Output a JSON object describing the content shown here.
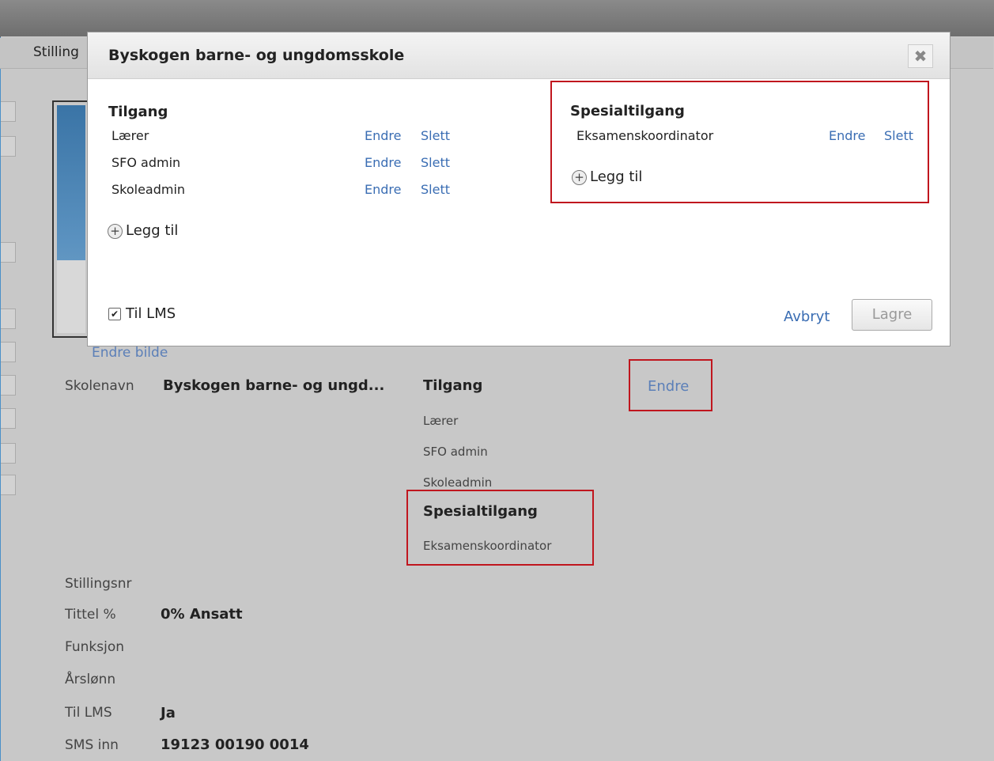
{
  "page": {
    "tab_label": "Stilling",
    "change_photo": "Endre bilde",
    "school": {
      "label": "Skolenavn",
      "value": "Byskogen barne- og ungd...",
      "access_heading": "Tilgang",
      "edit_link": "Endre",
      "access_items": [
        "Lærer",
        "SFO admin",
        "Skoleadmin"
      ],
      "special_heading": "Spesialtilgang",
      "special_items": [
        "Eksamenskoordinator"
      ]
    },
    "fields": [
      {
        "label": "Stillingsnr",
        "value": ""
      },
      {
        "label": "Tittel %",
        "value": "0% Ansatt"
      },
      {
        "label": "Funksjon",
        "value": ""
      },
      {
        "label": "Årslønn",
        "value": ""
      },
      {
        "label": "Til LMS",
        "value": "Ja"
      },
      {
        "label": "SMS inn",
        "value": "19123 00190 0014"
      }
    ]
  },
  "modal": {
    "title": "Byskogen barne- og ungdomsskole",
    "close_icon": "close-icon",
    "access": {
      "heading": "Tilgang",
      "rows": [
        {
          "name": "Lærer",
          "edit": "Endre",
          "delete": "Slett"
        },
        {
          "name": "SFO admin",
          "edit": "Endre",
          "delete": "Slett"
        },
        {
          "name": "Skoleadmin",
          "edit": "Endre",
          "delete": "Slett"
        }
      ],
      "add_label": "Legg til"
    },
    "special": {
      "heading": "Spesialtilgang",
      "rows": [
        {
          "name": "Eksamenskoordinator",
          "edit": "Endre",
          "delete": "Slett"
        }
      ],
      "add_label": "Legg til"
    },
    "lms_checkbox": {
      "label": "Til LMS",
      "checked": true
    },
    "cancel_label": "Avbryt",
    "save_label": "Lagre"
  },
  "colors": {
    "highlight": "#c0161e",
    "link": "#3a6db3",
    "overlay": "#c8c8c8"
  }
}
